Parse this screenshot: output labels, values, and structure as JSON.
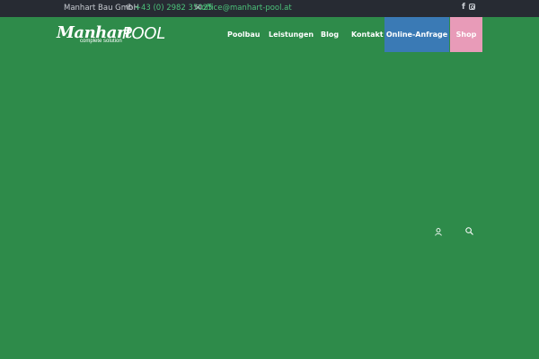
{
  "topbar": {
    "company": "Manhart Bau GmbH",
    "phone": "+43 (0) 2982 35025",
    "email": "office@manhart-pool.at",
    "social": [
      "facebook-icon",
      "instagram-icon"
    ]
  },
  "logo": {
    "word1": "Manhart",
    "word2": "POOL",
    "tagline": "complete solution"
  },
  "nav": {
    "poolbau": "Poolbau",
    "leistungen": "Leistungen",
    "blog": "Blog",
    "kontakt": "Kontakt",
    "anfrage": "Online-Anfrage",
    "shop": "Shop"
  },
  "colors": {
    "background": "#2e8b4a",
    "topbar": "#272b33",
    "accent_green": "#4cc37a",
    "anfrage_bg": "#3a7ab5",
    "shop_bg": "#e89bb8"
  },
  "icons": {
    "user": "user-icon",
    "search": "search-icon"
  }
}
